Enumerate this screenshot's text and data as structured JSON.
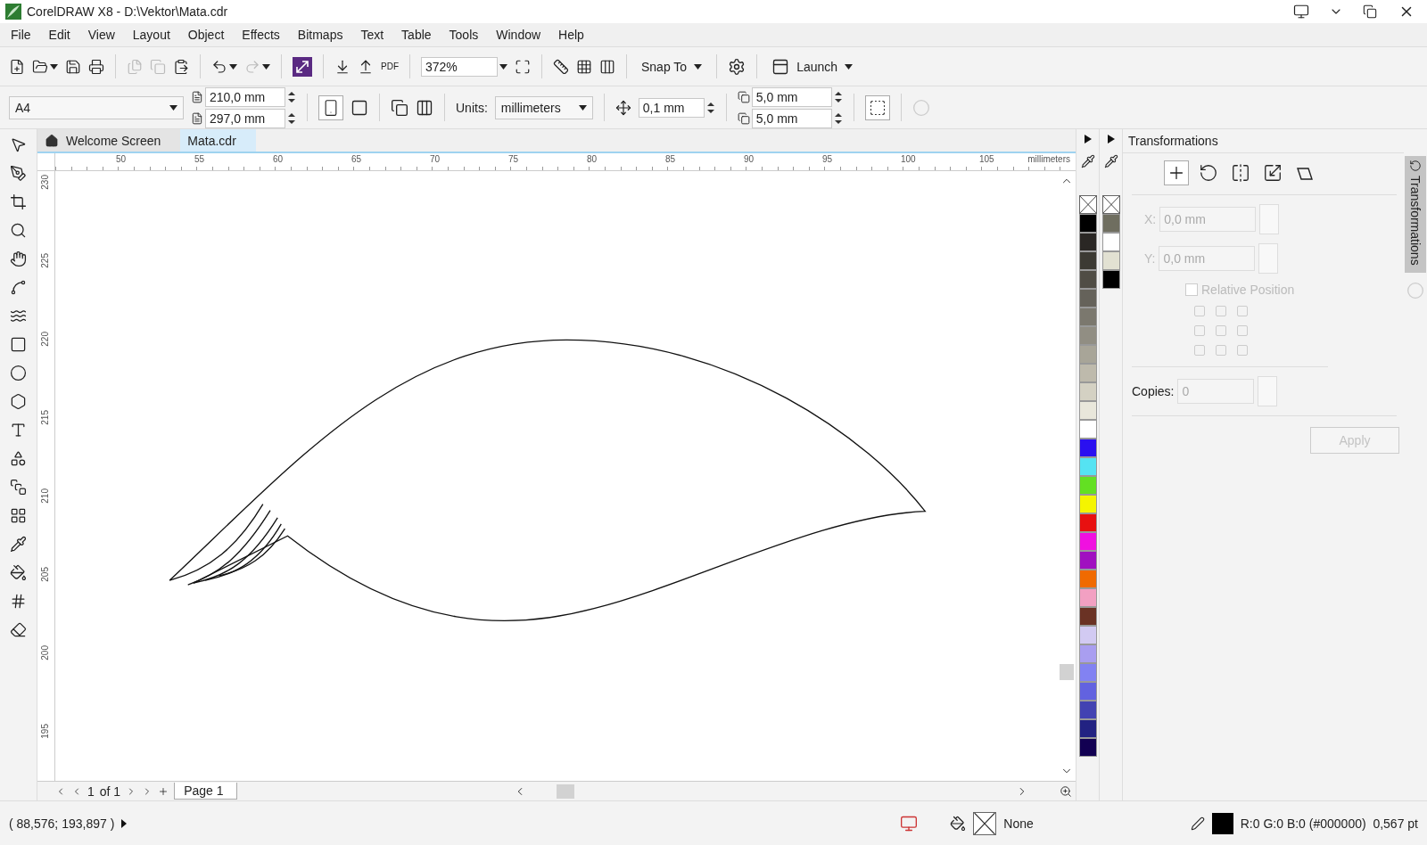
{
  "window": {
    "title": "CorelDRAW X8 - D:\\Vektor\\Mata.cdr"
  },
  "menu": [
    "File",
    "Edit",
    "View",
    "Layout",
    "Object",
    "Effects",
    "Bitmaps",
    "Text",
    "Table",
    "Tools",
    "Window",
    "Help"
  ],
  "toolbar": {
    "pdf_label": "PDF",
    "zoom": "372%",
    "snap_to": "Snap To",
    "launch": "Launch"
  },
  "property_bar": {
    "page_size": "A4",
    "width": "210,0 mm",
    "height": "297,0 mm",
    "units_label": "Units:",
    "units": "millimeters",
    "nudge": "0,1 mm",
    "dup_x": "5,0 mm",
    "dup_y": "5,0 mm"
  },
  "tabs": [
    {
      "label": "Welcome Screen",
      "selected": false,
      "kind": "home"
    },
    {
      "label": "Mata.cdr",
      "selected": true,
      "kind": "document"
    }
  ],
  "ruler": {
    "h_labels": [
      "50",
      "55",
      "60",
      "65",
      "70",
      "75",
      "80",
      "85",
      "90",
      "95",
      "100",
      "105"
    ],
    "unit": "millimeters",
    "v_labels": [
      "230",
      "225",
      "220",
      "215",
      "210",
      "205",
      "200",
      "195"
    ]
  },
  "page_nav": {
    "current": "1",
    "of": "of 1",
    "page_tab": "Page 1"
  },
  "palettes": [
    {
      "swatches": [
        {
          "kind": "none"
        },
        {
          "kind": "color",
          "color": "#000000"
        },
        {
          "kind": "color",
          "color": "#2a2724"
        },
        {
          "kind": "color",
          "color": "#3c3a33"
        },
        {
          "kind": "color",
          "color": "#504d45"
        },
        {
          "kind": "color",
          "color": "#65625a"
        },
        {
          "kind": "color",
          "color": "#7b786e"
        },
        {
          "kind": "color",
          "color": "#918e83"
        },
        {
          "kind": "color",
          "color": "#a8a598"
        },
        {
          "kind": "color",
          "color": "#bebaac"
        },
        {
          "kind": "color",
          "color": "#d4d1c3"
        },
        {
          "kind": "color",
          "color": "#e9e7db"
        },
        {
          "kind": "color",
          "color": "#ffffff"
        },
        {
          "kind": "color",
          "color": "#2a10f0"
        },
        {
          "kind": "color",
          "color": "#55e3f2"
        },
        {
          "kind": "color",
          "color": "#63e022"
        },
        {
          "kind": "color",
          "color": "#f5f500"
        },
        {
          "kind": "color",
          "color": "#e81010"
        },
        {
          "kind": "color",
          "color": "#f010e0"
        },
        {
          "kind": "color",
          "color": "#a010c0"
        },
        {
          "kind": "color",
          "color": "#f06a00"
        },
        {
          "kind": "color",
          "color": "#f2a0c2"
        },
        {
          "kind": "color",
          "color": "#6a3224"
        },
        {
          "kind": "color",
          "color": "#d2caf2"
        },
        {
          "kind": "color",
          "color": "#a99ef0"
        },
        {
          "kind": "color",
          "color": "#8282f2"
        },
        {
          "kind": "color",
          "color": "#6262e0"
        },
        {
          "kind": "color",
          "color": "#4242b2"
        },
        {
          "kind": "color",
          "color": "#222282"
        },
        {
          "kind": "color",
          "color": "#120052"
        }
      ]
    },
    {
      "swatches": [
        {
          "kind": "none"
        },
        {
          "kind": "color",
          "color": "#6f6e60"
        },
        {
          "kind": "color",
          "color": "#ffffff"
        },
        {
          "kind": "color",
          "color": "#e2e1d2"
        },
        {
          "kind": "color",
          "color": "#000000"
        }
      ]
    }
  ],
  "docker": {
    "title": "Transformations",
    "modes": [
      {
        "kind": "position",
        "selected": true
      },
      {
        "kind": "rotate",
        "selected": false
      },
      {
        "kind": "mirror",
        "selected": false
      },
      {
        "kind": "size",
        "selected": false
      },
      {
        "kind": "skew",
        "selected": false
      }
    ],
    "x_label": "X:",
    "x": "0,0 mm",
    "y_label": "Y:",
    "y": "0,0 mm",
    "fields_disabled": true,
    "relative_position": {
      "label": "Relative Position",
      "checked": false,
      "disabled": true
    },
    "anchors": [
      {
        "checked": false
      },
      {
        "checked": false
      },
      {
        "checked": false
      },
      {
        "checked": false
      },
      {
        "checked": false
      },
      {
        "checked": false
      },
      {
        "checked": false
      },
      {
        "checked": false
      },
      {
        "checked": false
      }
    ],
    "copies_label": "Copies:",
    "copies": "0",
    "apply": {
      "label": "Apply",
      "disabled": true
    },
    "side_tab": "Transformations"
  },
  "status": {
    "coords": "( 88,576; 193,897 )",
    "fill": "None",
    "outline": "R:0 G:0 B:0 (#000000)  0,567 pt"
  }
}
